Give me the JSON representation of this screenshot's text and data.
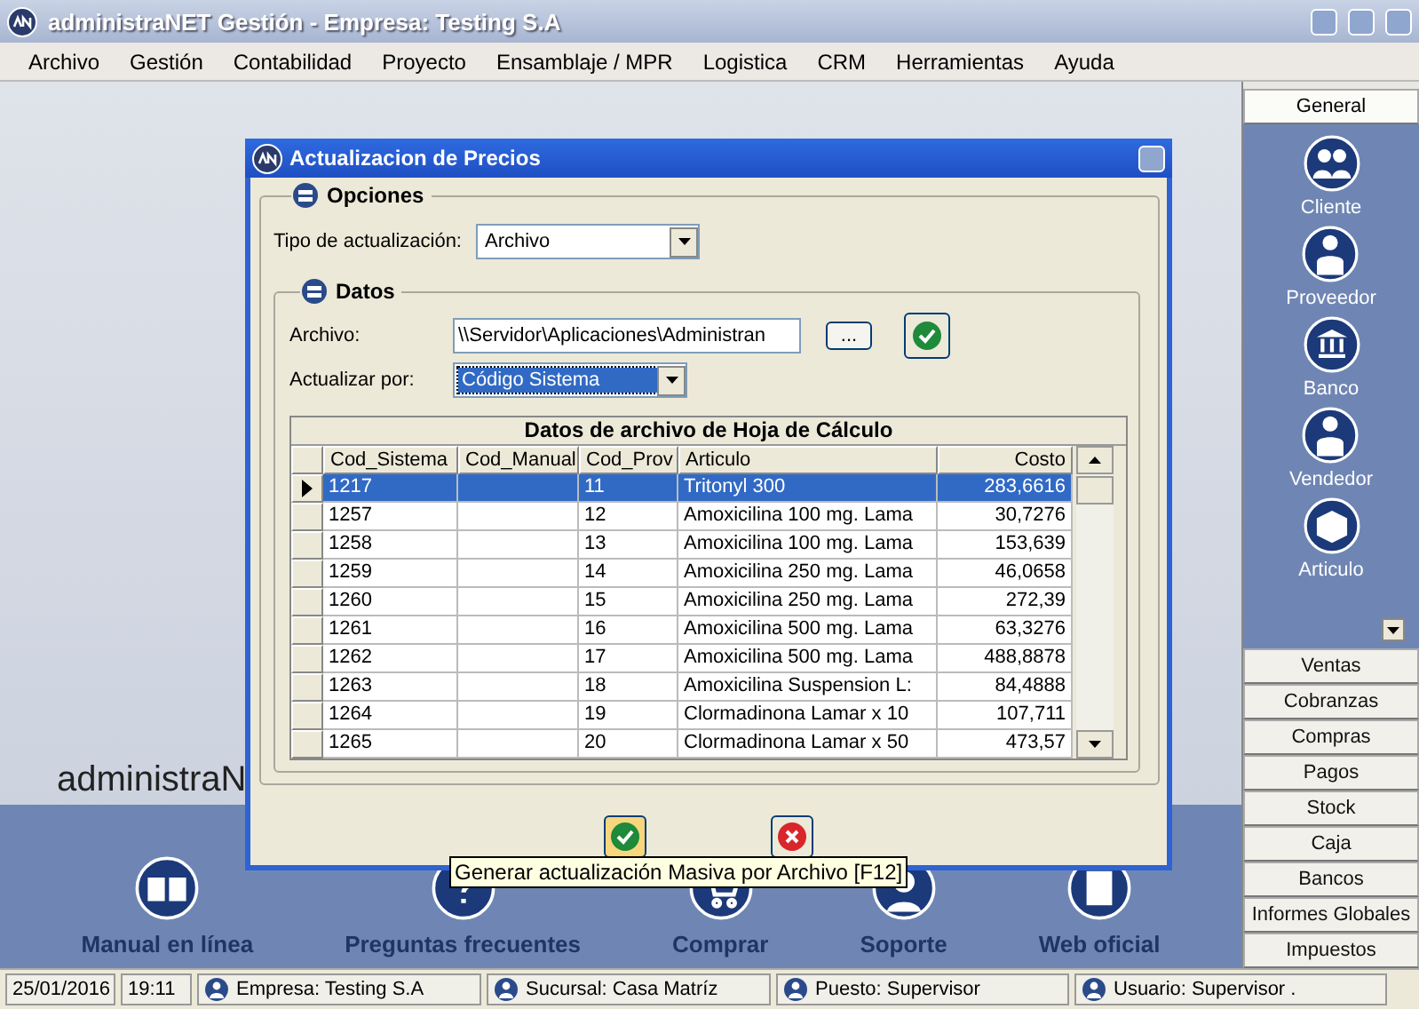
{
  "window": {
    "title": "administraNET Gestión - Empresa: Testing S.A"
  },
  "menu": [
    "Archivo",
    "Gestión",
    "Contabilidad",
    "Proyecto",
    "Ensamblaje / MPR",
    "Logistica",
    "CRM",
    "Herramientas",
    "Ayuda"
  ],
  "logo_text": "administraN",
  "shortcuts": [
    {
      "label": "Manual en línea",
      "kind": "book"
    },
    {
      "label": "Preguntas frecuentes",
      "kind": "question"
    },
    {
      "label": "Comprar",
      "kind": "cart"
    },
    {
      "label": "Soporte",
      "kind": "support"
    },
    {
      "label": "Web oficial",
      "kind": "web"
    }
  ],
  "sidebar": {
    "sections": [
      {
        "label": "General",
        "selected": true
      },
      {
        "label": "Ventas",
        "selected": false
      },
      {
        "label": "Cobranzas",
        "selected": false
      },
      {
        "label": "Compras",
        "selected": false
      },
      {
        "label": "Pagos",
        "selected": false
      },
      {
        "label": "Stock",
        "selected": false
      },
      {
        "label": "Caja",
        "selected": false
      },
      {
        "label": "Bancos",
        "selected": false
      },
      {
        "label": "Informes Globales",
        "selected": false
      },
      {
        "label": "Impuestos",
        "selected": false
      }
    ],
    "items": [
      {
        "label": "Cliente",
        "kind": "people"
      },
      {
        "label": "Proveedor",
        "kind": "supplier"
      },
      {
        "label": "Banco",
        "kind": "bank"
      },
      {
        "label": "Vendedor",
        "kind": "seller"
      },
      {
        "label": "Articulo",
        "kind": "box"
      }
    ]
  },
  "dialog": {
    "title": "Actualizacion de Precios",
    "options": {
      "title": "Opciones",
      "type_label": "Tipo de actualización:",
      "type_value": "Archivo"
    },
    "data": {
      "title": "Datos",
      "file_label": "Archivo:",
      "file_value": "\\\\Servidor\\Aplicaciones\\Administran",
      "browse_button": "...",
      "update_by_label": "Actualizar por:",
      "update_by_value": "Código Sistema"
    },
    "table": {
      "title": "Datos de archivo de Hoja de Cálculo",
      "columns": [
        "Cod_Sistema",
        "Cod_Manual",
        "Cod_Prov",
        "Articulo",
        "Costo"
      ],
      "rows": [
        {
          "cells": [
            "1217",
            "",
            "11",
            "Tritonyl 300",
            "283,6616"
          ],
          "selected": true
        },
        {
          "cells": [
            "1257",
            "",
            "12",
            "Amoxicilina 100 mg. Lama",
            "30,7276"
          ],
          "selected": false
        },
        {
          "cells": [
            "1258",
            "",
            "13",
            "Amoxicilina 100 mg. Lama",
            "153,639"
          ],
          "selected": false
        },
        {
          "cells": [
            "1259",
            "",
            "14",
            "Amoxicilina 250 mg. Lama",
            "46,0658"
          ],
          "selected": false
        },
        {
          "cells": [
            "1260",
            "",
            "15",
            "Amoxicilina 250 mg. Lama",
            "272,39"
          ],
          "selected": false
        },
        {
          "cells": [
            "1261",
            "",
            "16",
            "Amoxicilina 500 mg. Lama",
            "63,3276"
          ],
          "selected": false
        },
        {
          "cells": [
            "1262",
            "",
            "17",
            "Amoxicilina 500 mg. Lama",
            "488,8878"
          ],
          "selected": false
        },
        {
          "cells": [
            "1263",
            "",
            "18",
            "Amoxicilina Suspension L:",
            "84,4888"
          ],
          "selected": false
        },
        {
          "cells": [
            "1264",
            "",
            "19",
            "Clormadinona Lamar x  10",
            "107,711"
          ],
          "selected": false
        },
        {
          "cells": [
            "1265",
            "",
            "20",
            "Clormadinona Lamar x  50",
            "473,57"
          ],
          "selected": false
        }
      ]
    },
    "tooltip": "Generar actualización Masiva por Archivo [F12]"
  },
  "status_bar": [
    "25/01/2016",
    "19:11",
    "Empresa: Testing S.A",
    "Sucursal: Casa Matríz",
    "Puesto: Supervisor",
    "Usuario: Supervisor ."
  ]
}
